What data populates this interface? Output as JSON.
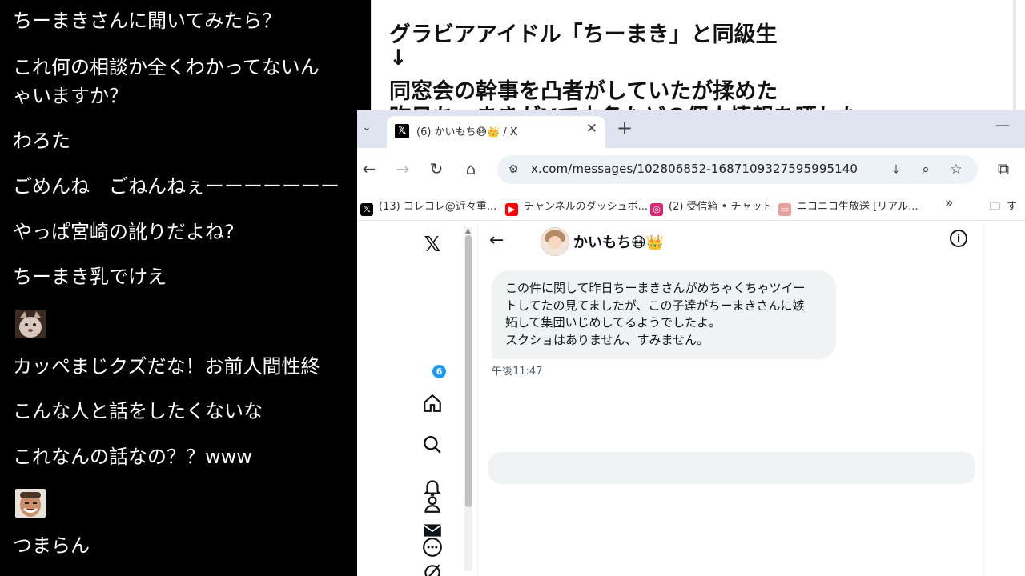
{
  "comments": [
    {
      "text": "ちーまきさんに聞いてみたら？"
    },
    {
      "text": "これ何の相談か全くわかってないんですけど、いらっしゃいますか？"
    },
    {
      "text": "わろた"
    },
    {
      "text": "ごめんね　ごねんねぇーーーーーーー"
    },
    {
      "text": "やっぱ宮崎の訛りだよね?"
    },
    {
      "text": "ちーまき乳でけえ"
    },
    {
      "text": "カッペまじクズだな！お前人間性終わってる"
    },
    {
      "text": "こんな人と話をしたくないな"
    },
    {
      "text": "これなんの話なの？？www"
    },
    {
      "text": "つまらん"
    }
  ],
  "comments_visible": {
    "line2a": "これ何の相談か全くわかってないん",
    "line2b": "ゃいますか？",
    "line4": "ごめんね　ごねんねぇーーーーーーー",
    "line7": "カッペまじクズだな！お前人間性終"
  },
  "memo": {
    "line1": "グラビアアイドル「ちーまき」と同級生",
    "arrow": "↓",
    "line2": "同窓会の幹事を凸者がしていたが揉めた",
    "line3": "昨日ちーまきがXで本名などの個人情報を晒した"
  },
  "browser": {
    "tab_title": "(6) かいもち😷👑 / X",
    "tab_close": "✕",
    "new_tab": "+",
    "minimize": "—",
    "url": "x.com/messages/102806852-1687109327595995140",
    "bookmarks": [
      {
        "label": "(13) コレコレ@近々重...",
        "icon": "x-icon",
        "color": "#000000"
      },
      {
        "label": "チャンネルのダッシュボ...",
        "icon": "youtube-icon",
        "color": "#ff0000"
      },
      {
        "label": "(2) 受信箱 • チャット",
        "icon": "instagram-icon",
        "color": "#d62976"
      },
      {
        "label": "ニコニコ生放送 [リアル...",
        "icon": "niconico-icon",
        "color": "#e7a09a"
      }
    ],
    "bookmarks_more": "»",
    "folder_label": "す"
  },
  "x": {
    "notification_count": "6",
    "dm_name": "かいもち😷👑",
    "message_lines": [
      "この件に関して昨日ちーまきさんがめちゃくちゃツイー",
      "トしてたの見てましたが、この子達がちーまきさんに嫉",
      "妬して集団いじめしてるようでしたよ。",
      "スクショはありません、すみません。"
    ],
    "message_time": "午後11:47",
    "accent": "#1d9bf0"
  }
}
